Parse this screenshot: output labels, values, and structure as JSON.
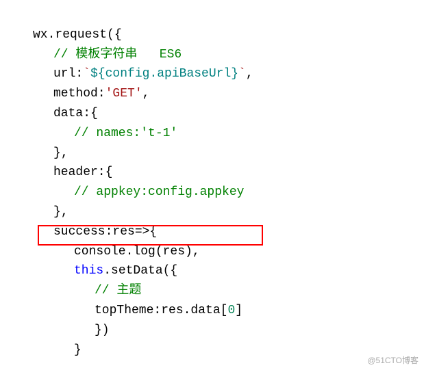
{
  "lines": {
    "l0_pre": "// ",
    "l0_post": " ———",
    "l1a": "wx.request",
    "l1b": "{",
    "comment_tmpl": "// 模板字符串   ES6",
    "url_key": "url:",
    "url_tmpl_open": "`",
    "url_tmpl_expr": "${config.apiBaseUrl}",
    "url_tmpl_close": "`",
    "comma": ",",
    "method_key": "method:",
    "method_val": "'GET'",
    "data_key": "data:{",
    "names_comment": "// names:'t-1'",
    "brace_close": "}",
    "header_key": "header:{",
    "appkey_comment": "// appkey:config.appkey",
    "success_line": "success:res=>{",
    "console_log": "console.log(res),",
    "this_kw": "this",
    "setdata_txt": ".setData({",
    "theme_comment": "// 主题",
    "toptheme_a": "topTheme:res.data[",
    "toptheme_n": "0",
    "toptheme_b": "]",
    "brace_close_paren": "})"
  },
  "watermark": "@51CTO博客"
}
